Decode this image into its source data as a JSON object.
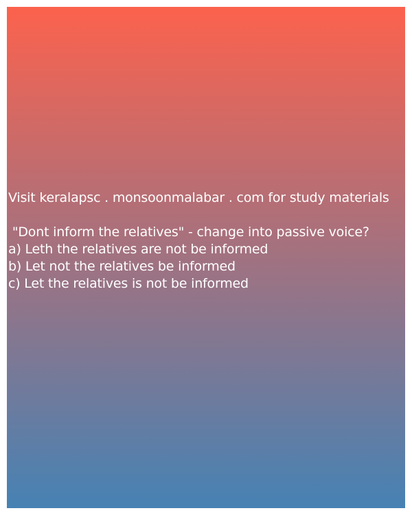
{
  "colors": {
    "gradient_top": "#fc624d",
    "gradient_bottom": "#4682b4",
    "text": "#ffffff"
  },
  "header_text": "Visit keralapsc . monsoonmalabar . com for study materials",
  "question": {
    "text": " \"Dont inform the relatives\" - change into passive voice?",
    "options": [
      "a) Leth the relatives are not be informed",
      "b) Let not the relatives be informed",
      "c) Let the relatives is not be informed"
    ]
  }
}
